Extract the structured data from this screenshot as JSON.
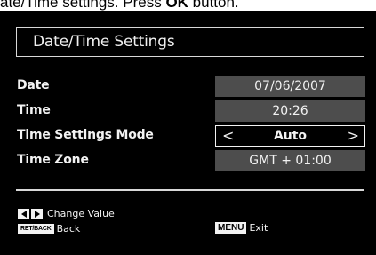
{
  "caption": {
    "prefix": "ate/Time settings. Press ",
    "button": "OK",
    "suffix": " button."
  },
  "dialog": {
    "title": "Date/Time Settings",
    "rows": [
      {
        "label": "Date",
        "value": "07/06/2007"
      },
      {
        "label": "Time",
        "value": "20:26"
      },
      {
        "label": "Time Settings Mode",
        "value": "Auto",
        "selected": true
      },
      {
        "label": "Time Zone",
        "value": "GMT + 01:00"
      }
    ]
  },
  "help": {
    "change_value": "Change Value",
    "back_key": "RET/BACK",
    "back": "Back",
    "menu_key": "MENU",
    "exit": "Exit"
  },
  "colors": {
    "screen_background": "#000000",
    "value_box": "#4d4d4d",
    "text": "#f2f2f2"
  },
  "icons": {
    "left_arrow": "arrow-left-icon",
    "right_arrow": "arrow-right-icon",
    "selector_left": "chevron-left-icon",
    "selector_right": "chevron-right-icon"
  }
}
